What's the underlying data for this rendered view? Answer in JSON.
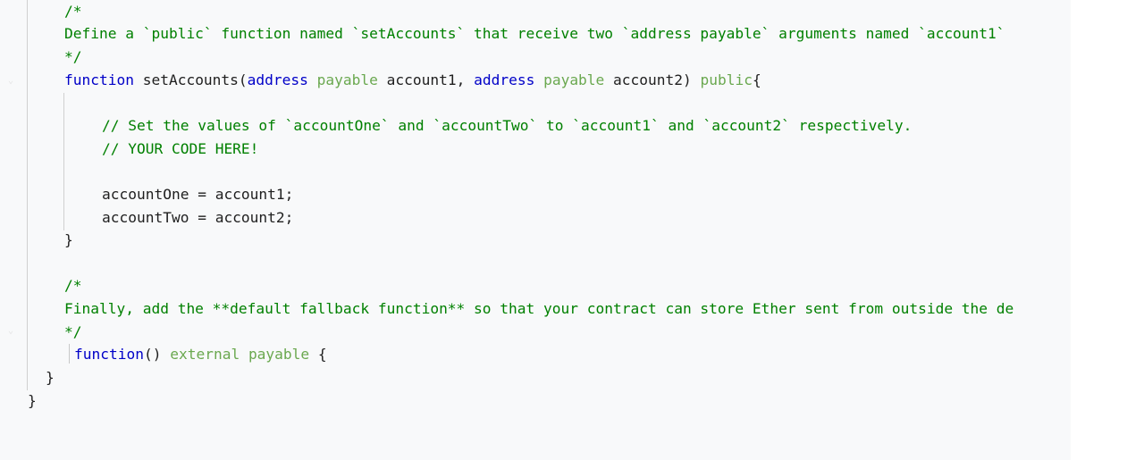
{
  "lines": [
    {
      "parts": [
        {
          "cls": "c",
          "text": "/*"
        }
      ]
    },
    {
      "parts": [
        {
          "cls": "c",
          "text": "Define a `public` function named `setAccounts` that receive two `address payable` arguments named `account1`"
        }
      ]
    },
    {
      "parts": [
        {
          "cls": "c",
          "text": "*/"
        }
      ]
    },
    {
      "parts": [
        {
          "cls": "k",
          "text": "function"
        },
        {
          "cls": "t",
          "text": " setAccounts("
        },
        {
          "cls": "k",
          "text": "address"
        },
        {
          "cls": "t",
          "text": " "
        },
        {
          "cls": "p",
          "text": "payable"
        },
        {
          "cls": "t",
          "text": " account1, "
        },
        {
          "cls": "k",
          "text": "address"
        },
        {
          "cls": "t",
          "text": " "
        },
        {
          "cls": "p",
          "text": "payable"
        },
        {
          "cls": "t",
          "text": " account2) "
        },
        {
          "cls": "p",
          "text": "public"
        },
        {
          "cls": "t",
          "text": "{"
        }
      ]
    },
    {
      "parts": []
    },
    {
      "parts": [
        {
          "cls": "c",
          "text": "// Set the values of `accountOne` and `accountTwo` to `account1` and `account2` respectively."
        }
      ]
    },
    {
      "parts": [
        {
          "cls": "c",
          "text": "// YOUR CODE HERE!"
        }
      ]
    },
    {
      "parts": []
    },
    {
      "parts": [
        {
          "cls": "t",
          "text": "accountOne = account1;"
        }
      ]
    },
    {
      "parts": [
        {
          "cls": "t",
          "text": "accountTwo = account2;"
        }
      ]
    },
    {
      "parts": [
        {
          "cls": "t",
          "text": "}"
        }
      ]
    },
    {
      "parts": []
    },
    {
      "parts": [
        {
          "cls": "c",
          "text": "/*"
        }
      ]
    },
    {
      "parts": [
        {
          "cls": "c",
          "text": "Finally, add the **default fallback function** so that your contract can store Ether sent from outside the de"
        }
      ]
    },
    {
      "parts": [
        {
          "cls": "c",
          "text": "*/"
        }
      ]
    },
    {
      "parts": [
        {
          "cls": "k",
          "text": "function"
        },
        {
          "cls": "t",
          "text": "() "
        },
        {
          "cls": "p",
          "text": "external"
        },
        {
          "cls": "t",
          "text": " "
        },
        {
          "cls": "p",
          "text": "payable"
        },
        {
          "cls": "t",
          "text": " {"
        }
      ]
    },
    {
      "parts": [
        {
          "cls": "t",
          "text": "}"
        }
      ]
    },
    {
      "parts": [
        {
          "cls": "t",
          "text": "}"
        }
      ]
    }
  ]
}
